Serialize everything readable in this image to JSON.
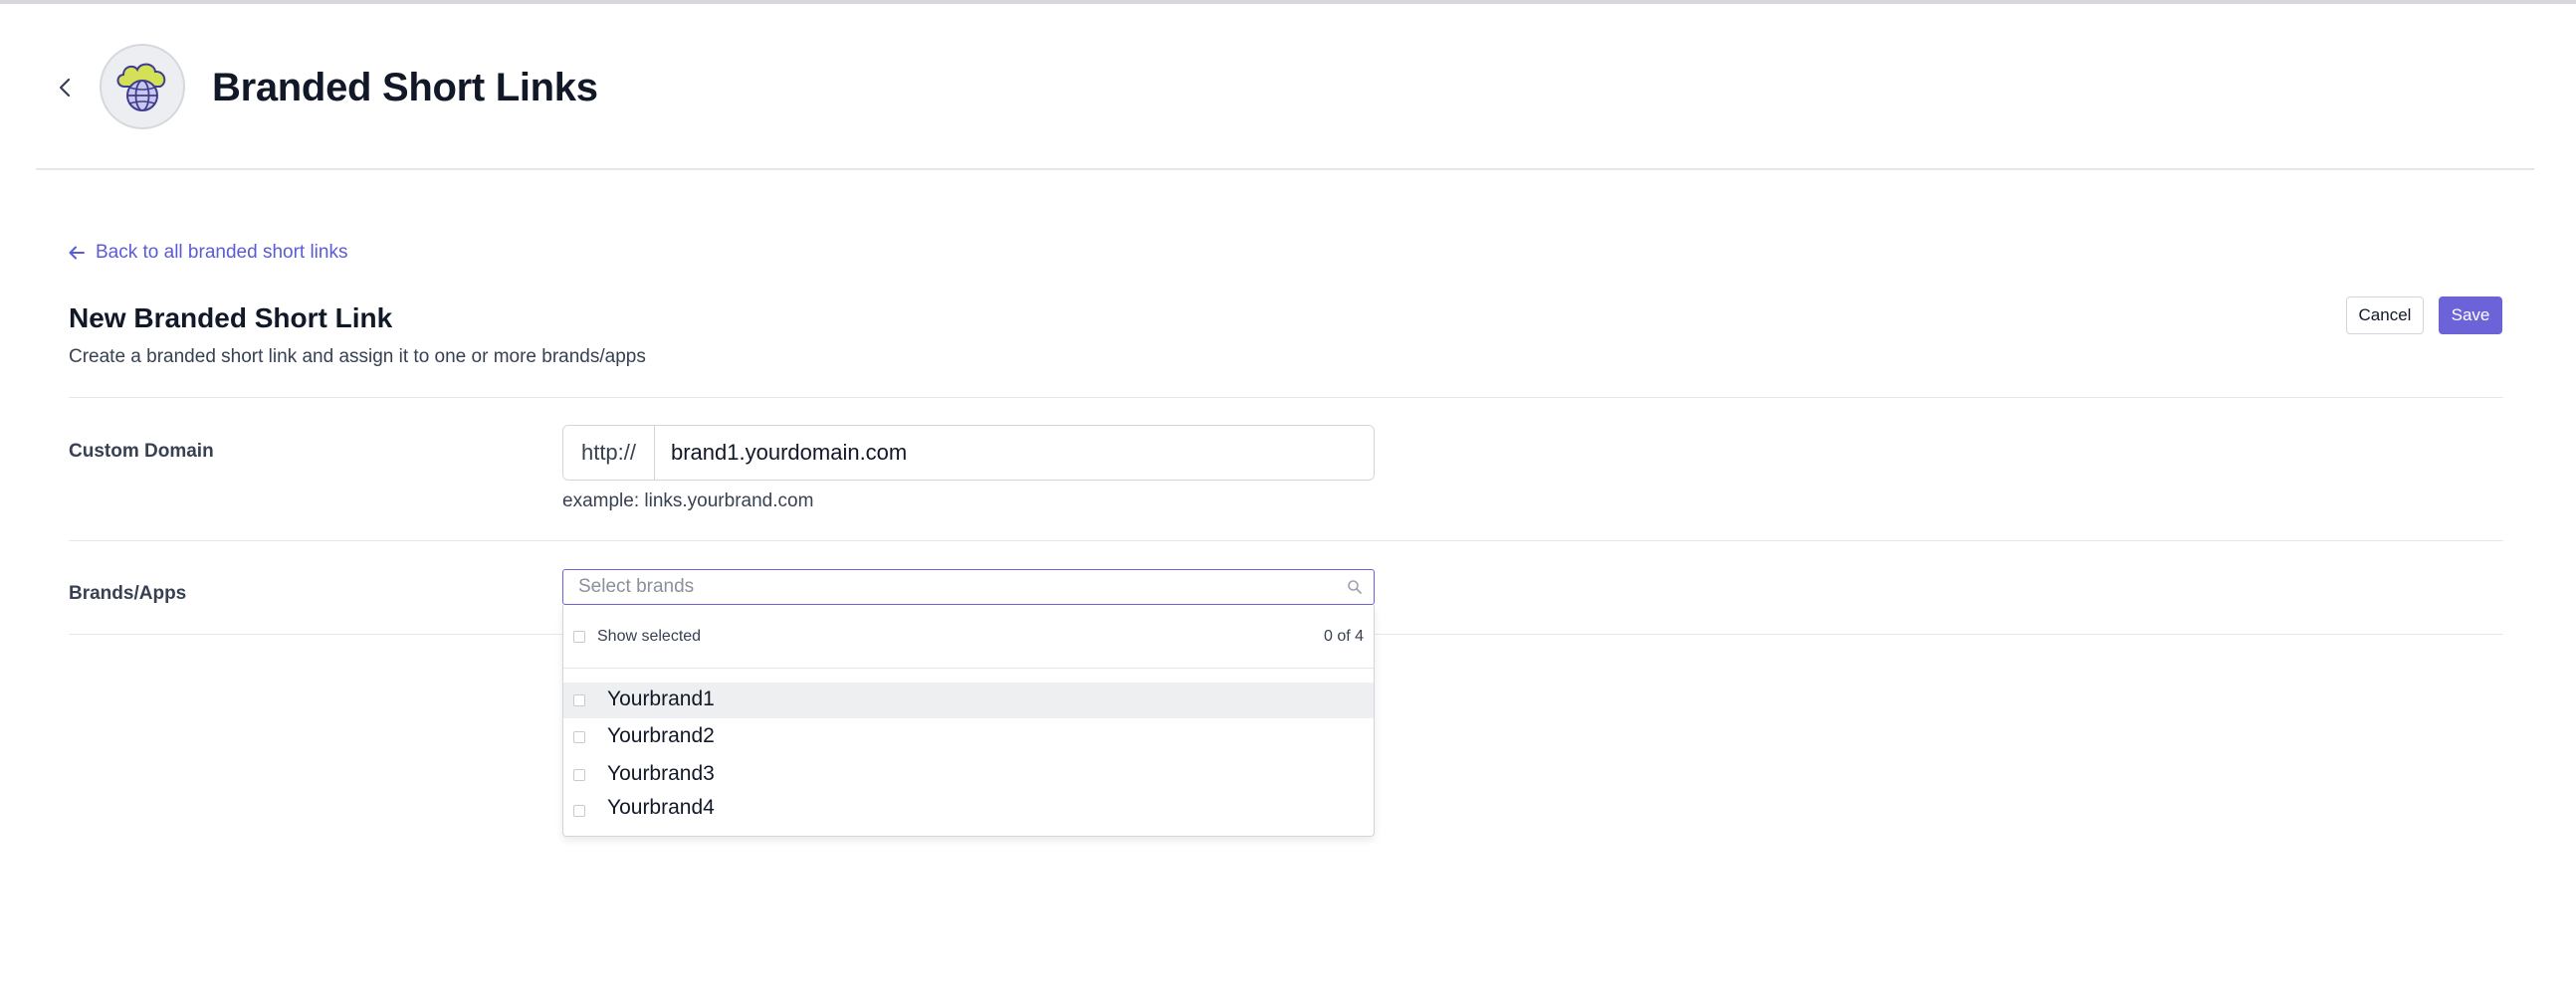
{
  "header": {
    "title": "Branded Short Links",
    "back_icon": "chevron-left-icon",
    "logo_icon": "cloud-globe-icon"
  },
  "nav": {
    "back_link_label": "Back to all branded short links",
    "back_link_icon": "arrow-left-icon"
  },
  "form": {
    "title": "New Branded Short Link",
    "subtitle": "Create a branded short link and assign it to one or more brands/apps",
    "cancel_label": "Cancel",
    "save_label": "Save",
    "custom_domain": {
      "label": "Custom Domain",
      "prefix": "http://",
      "value": "brand1.yourdomain.com",
      "help": "example: links.yourbrand.com"
    },
    "brands": {
      "label": "Brands/Apps",
      "placeholder": "Select brands",
      "show_selected_label": "Show selected",
      "count_label": "0 of 4",
      "options": [
        {
          "label": "Yourbrand1",
          "checked": false
        },
        {
          "label": "Yourbrand2",
          "checked": false
        },
        {
          "label": "Yourbrand3",
          "checked": false
        },
        {
          "label": "Yourbrand4",
          "checked": false
        }
      ]
    }
  },
  "colors": {
    "accent": "#6c63d9",
    "link": "#5b5bd6",
    "logo_cloud": "#d4e157",
    "logo_globe": "#3f3d8f"
  }
}
